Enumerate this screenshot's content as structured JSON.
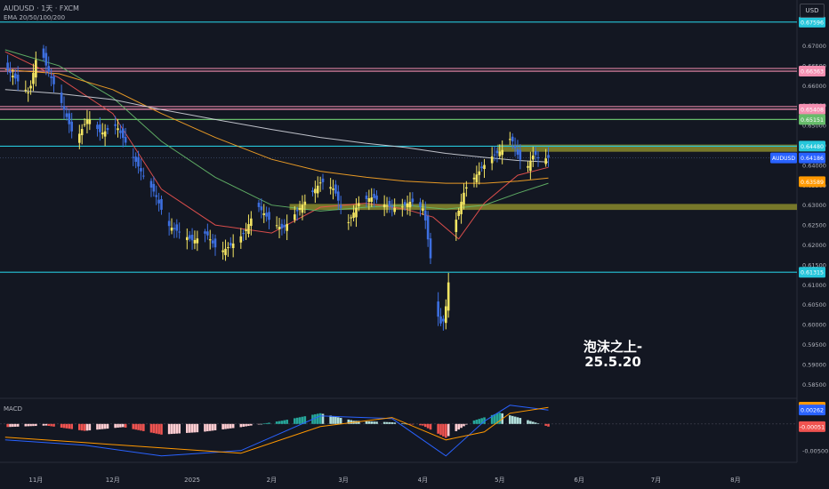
{
  "header": {
    "symbol_line": "AUDUSD · 1天 · FXCM",
    "indicator_line": "EMA 20/50/100/200",
    "macd_label": "MACD",
    "currency_button": "USD"
  },
  "annotation": {
    "line1": "泡沫之上-",
    "line2": "25.5.20"
  },
  "x_axis_labels": [
    "11月",
    "12月",
    "2025",
    "2月",
    "3月",
    "4月",
    "5月",
    "6月",
    "7月",
    "8月"
  ],
  "price_axis_ticks": [
    "0.67000",
    "0.66500",
    "0.66000",
    "0.65500",
    "0.65000",
    "0.64500",
    "0.64000",
    "0.63500",
    "0.63000",
    "0.62500",
    "0.62000",
    "0.61500",
    "0.61000",
    "0.60500",
    "0.60000",
    "0.59500",
    "0.59000",
    "0.58500"
  ],
  "macd_axis_ticks": [
    "-0.00500"
  ],
  "horizontal_levels": [
    {
      "price": 0.67596,
      "label": "0.67596",
      "color": "#26c6da"
    },
    {
      "price": 0.66363,
      "label": "0.66363",
      "color": "#f48fb1"
    },
    {
      "price": 0.65408,
      "label": "0.65408",
      "color": "#f48fb1"
    },
    {
      "price": 0.65151,
      "label": "0.65151",
      "color": "#66bb6a"
    },
    {
      "price": 0.6448,
      "label": "0.64480",
      "color": "#26c6da"
    },
    {
      "price": 0.61315,
      "label": "0.61315",
      "color": "#26c6da"
    }
  ],
  "current_price": {
    "symbol": "AUDUSD",
    "price": 0.64186,
    "label": "0.64186",
    "color": "#2962ff"
  },
  "ema_price_tag": {
    "label": "0.63589",
    "price": 0.63589,
    "color": "#ff9800"
  },
  "macd_tags": [
    {
      "label": "0.00313",
      "value": 0.00313,
      "color": "#ff9800"
    },
    {
      "label": "0.00262",
      "value": 0.00262,
      "color": "#2962ff"
    },
    {
      "label": "-0.00051",
      "value": -0.00051,
      "color": "#ef5350"
    }
  ],
  "zones": [
    {
      "from": 0.6434,
      "to": 0.6452,
      "start_date": "2025-04-30",
      "color": "#8a8a2c"
    },
    {
      "from": 0.6288,
      "to": 0.6303,
      "start_date": "2025-02-08",
      "color": "#8a8a2c"
    }
  ],
  "chart_data": {
    "type": "candlestick",
    "symbol": "AUDUSD",
    "timeframe": "1天",
    "ylim": [
      0.5815,
      0.6815
    ],
    "macd_ylim": [
      -0.0072,
      0.0048
    ],
    "series": [
      {
        "name": "EMA 20",
        "color": "#ef5350",
        "points": [
          [
            "2024-10-20",
            0.6685
          ],
          [
            "2024-11-10",
            0.662
          ],
          [
            "2024-12-01",
            0.653
          ],
          [
            "2024-12-20",
            0.634
          ],
          [
            "2025-01-10",
            0.625
          ],
          [
            "2025-02-01",
            0.623
          ],
          [
            "2025-02-20",
            0.6295
          ],
          [
            "2025-03-10",
            0.6305
          ],
          [
            "2025-03-25",
            0.629
          ],
          [
            "2025-04-05",
            0.627
          ],
          [
            "2025-04-15",
            0.6215
          ],
          [
            "2025-04-25",
            0.6305
          ],
          [
            "2025-05-08",
            0.6375
          ],
          [
            "2025-05-20",
            0.6395
          ]
        ]
      },
      {
        "name": "EMA 50",
        "color": "#66bb6a",
        "points": [
          [
            "2024-10-20",
            0.669
          ],
          [
            "2024-11-10",
            0.665
          ],
          [
            "2024-12-01",
            0.657
          ],
          [
            "2024-12-20",
            0.646
          ],
          [
            "2025-01-10",
            0.637
          ],
          [
            "2025-02-01",
            0.63
          ],
          [
            "2025-02-20",
            0.6285
          ],
          [
            "2025-03-10",
            0.6295
          ],
          [
            "2025-03-25",
            0.63
          ],
          [
            "2025-04-10",
            0.629
          ],
          [
            "2025-04-25",
            0.63
          ],
          [
            "2025-05-08",
            0.633
          ],
          [
            "2025-05-20",
            0.6355
          ]
        ]
      },
      {
        "name": "EMA 100",
        "color": "#ffa726",
        "points": [
          [
            "2024-10-20",
            0.664
          ],
          [
            "2024-11-10",
            0.663
          ],
          [
            "2024-12-01",
            0.659
          ],
          [
            "2024-12-20",
            0.653
          ],
          [
            "2025-01-10",
            0.647
          ],
          [
            "2025-02-01",
            0.6415
          ],
          [
            "2025-02-20",
            0.6385
          ],
          [
            "2025-03-10",
            0.637
          ],
          [
            "2025-03-25",
            0.636
          ],
          [
            "2025-04-10",
            0.6355
          ],
          [
            "2025-04-25",
            0.6355
          ],
          [
            "2025-05-08",
            0.636
          ],
          [
            "2025-05-20",
            0.6368
          ]
        ]
      },
      {
        "name": "EMA 200",
        "color": "#d1d4dc",
        "points": [
          [
            "2024-10-20",
            0.659
          ],
          [
            "2024-11-10",
            0.658
          ],
          [
            "2024-12-01",
            0.6565
          ],
          [
            "2024-12-20",
            0.654
          ],
          [
            "2025-01-10",
            0.6515
          ],
          [
            "2025-02-01",
            0.649
          ],
          [
            "2025-02-20",
            0.647
          ],
          [
            "2025-03-10",
            0.6455
          ],
          [
            "2025-03-25",
            0.6445
          ],
          [
            "2025-04-10",
            0.643
          ],
          [
            "2025-04-25",
            0.642
          ],
          [
            "2025-05-08",
            0.6412
          ],
          [
            "2025-05-20",
            0.6408
          ]
        ]
      }
    ],
    "price_path": [
      [
        "2024-10-20",
        0.665
      ],
      [
        "2024-10-25",
        0.6615
      ],
      [
        "2024-10-30",
        0.658
      ],
      [
        "2024-11-03",
        0.671
      ],
      [
        "2024-11-05",
        0.666
      ],
      [
        "2024-11-12",
        0.655
      ],
      [
        "2024-11-17",
        0.646
      ],
      [
        "2024-11-22",
        0.652
      ],
      [
        "2024-11-27",
        0.648
      ],
      [
        "2024-12-03",
        0.65
      ],
      [
        "2024-12-08",
        0.644
      ],
      [
        "2024-12-13",
        0.638
      ],
      [
        "2024-12-18",
        0.633
      ],
      [
        "2024-12-23",
        0.625
      ],
      [
        "2024-12-28",
        0.623
      ],
      [
        "2025-01-02",
        0.621
      ],
      [
        "2025-01-07",
        0.623
      ],
      [
        "2025-01-12",
        0.618
      ],
      [
        "2025-01-17",
        0.62
      ],
      [
        "2025-01-22",
        0.623
      ],
      [
        "2025-01-27",
        0.63
      ],
      [
        "2025-02-01",
        0.626
      ],
      [
        "2025-02-06",
        0.624
      ],
      [
        "2025-02-11",
        0.628
      ],
      [
        "2025-02-16",
        0.632
      ],
      [
        "2025-02-21",
        0.636
      ],
      [
        "2025-02-26",
        0.634
      ],
      [
        "2025-03-03",
        0.625
      ],
      [
        "2025-03-08",
        0.631
      ],
      [
        "2025-03-13",
        0.632
      ],
      [
        "2025-03-18",
        0.63
      ],
      [
        "2025-03-23",
        0.629
      ],
      [
        "2025-03-28",
        0.631
      ],
      [
        "2025-04-02",
        0.629
      ],
      [
        "2025-04-06",
        0.61
      ],
      [
        "2025-04-08",
        0.6
      ],
      [
        "2025-04-10",
        0.601
      ],
      [
        "2025-04-14",
        0.625
      ],
      [
        "2025-04-18",
        0.634
      ],
      [
        "2025-04-23",
        0.638
      ],
      [
        "2025-04-28",
        0.642
      ],
      [
        "2025-05-03",
        0.644
      ],
      [
        "2025-05-06",
        0.647
      ],
      [
        "2025-05-09",
        0.642
      ],
      [
        "2025-05-12",
        0.639
      ],
      [
        "2025-05-15",
        0.643
      ],
      [
        "2025-05-18",
        0.641
      ],
      [
        "2025-05-20",
        0.6419
      ]
    ],
    "macd": {
      "histogram": [
        [
          "2024-10-20",
          -0.0006
        ],
        [
          "2024-11-05",
          -0.0003
        ],
        [
          "2024-11-20",
          -0.0013
        ],
        [
          "2024-12-05",
          -0.0006
        ],
        [
          "2024-12-20",
          -0.002
        ],
        [
          "2025-01-05",
          -0.0015
        ],
        [
          "2025-01-20",
          -0.0006
        ],
        [
          "2025-02-05",
          0.0006
        ],
        [
          "2025-02-20",
          0.002
        ],
        [
          "2025-03-05",
          0.0006
        ],
        [
          "2025-03-20",
          0.0003
        ],
        [
          "2025-04-01",
          -0.0003
        ],
        [
          "2025-04-10",
          -0.0026
        ],
        [
          "2025-04-20",
          0.0005
        ],
        [
          "2025-05-01",
          0.0021
        ],
        [
          "2025-05-10",
          0.001
        ],
        [
          "2025-05-20",
          -0.0005
        ]
      ],
      "macd_line": [
        [
          "2024-10-20",
          -0.003
        ],
        [
          "2024-11-20",
          -0.004
        ],
        [
          "2024-12-20",
          -0.006
        ],
        [
          "2025-01-20",
          -0.005
        ],
        [
          "2025-02-20",
          0.0015
        ],
        [
          "2025-03-20",
          0.001
        ],
        [
          "2025-04-10",
          -0.006
        ],
        [
          "2025-04-25",
          0.0005
        ],
        [
          "2025-05-05",
          0.0035
        ],
        [
          "2025-05-20",
          0.0026
        ]
      ],
      "signal_line": [
        [
          "2024-10-20",
          -0.0025
        ],
        [
          "2024-11-20",
          -0.0035
        ],
        [
          "2024-12-20",
          -0.0045
        ],
        [
          "2025-01-20",
          -0.0055
        ],
        [
          "2025-02-20",
          -0.0005
        ],
        [
          "2025-03-20",
          0.0012
        ],
        [
          "2025-04-10",
          -0.003
        ],
        [
          "2025-04-25",
          -0.0015
        ],
        [
          "2025-05-05",
          0.002
        ],
        [
          "2025-05-20",
          0.0031
        ]
      ]
    }
  }
}
